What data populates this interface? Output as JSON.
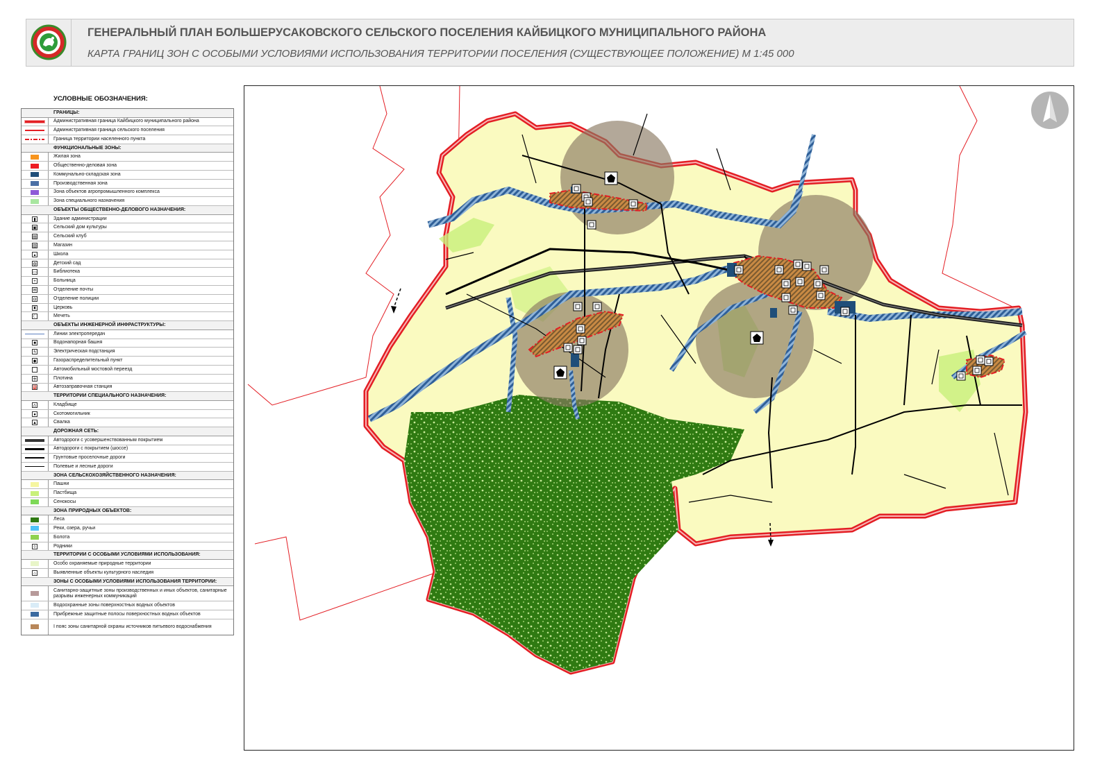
{
  "header": {
    "title": "ГЕНЕРАЛЬНЫЙ ПЛАН БОЛЬШЕРУСАКОВСКОГО СЕЛЬСКОГО ПОСЕЛЕНИЯ КАЙБИЦКОГО МУНИЦИПАЛЬНОГО РАЙОНА",
    "subtitle": "КАРТА ГРАНИЦ ЗОН С ОСОБЫМИ УСЛОВИЯМИ ИСПОЛЬЗОВАНИЯ ТЕРРИТОРИИ ПОСЕЛЕНИЯ (СУЩЕСТВУЮЩЕЕ ПОЛОЖЕНИЕ)  М 1:45 000"
  },
  "legend": {
    "title": "УСЛОВНЫЕ ОБОЗНАЧЕНИЯ:",
    "sections": [
      {
        "title": "ГРАНИЦЫ:",
        "items": [
          {
            "label": "Административная граница Кайбицкого муниципального района",
            "kind": "line",
            "color": "#e31e24",
            "style": "double"
          },
          {
            "label": "Административная граница сельского поселения",
            "kind": "line",
            "color": "#e31e24",
            "style": "solid"
          },
          {
            "label": "Граница территории населенного пункта",
            "kind": "line",
            "color": "#e31e24",
            "style": "dashdot"
          }
        ]
      },
      {
        "title": "ФУНКЦИОНАЛЬНЫЕ ЗОНЫ:",
        "items": [
          {
            "label": "Жилая зона",
            "kind": "box",
            "color": "#f7941d"
          },
          {
            "label": "Общественно-деловая зона",
            "kind": "box",
            "color": "#ed1c24"
          },
          {
            "label": "Коммунально-складская зона",
            "kind": "box",
            "color": "#1f4e79"
          },
          {
            "label": "Производственная зона",
            "kind": "box",
            "color": "#4a6fa5"
          },
          {
            "label": "Зона объектов агропромышленного комплекса",
            "kind": "box",
            "color": "#8e5ad8"
          },
          {
            "label": "Зона специального назначения",
            "kind": "box",
            "color": "#a8e6a0"
          }
        ]
      },
      {
        "title": "ОБЪЕКТЫ ОБЩЕСТВЕННО-ДЕЛОВОГО НАЗНАЧЕНИЯ:",
        "items": [
          {
            "label": "Здание администрации",
            "kind": "icon",
            "glyph": "▮"
          },
          {
            "label": "Сельский дом культуры",
            "kind": "icon",
            "glyph": "▣"
          },
          {
            "label": "Сельский клуб",
            "kind": "icon",
            "glyph": "▤"
          },
          {
            "label": "Магазин",
            "kind": "icon",
            "glyph": "▥"
          },
          {
            "label": "Школа",
            "kind": "icon",
            "glyph": "▴"
          },
          {
            "label": "Детский сад",
            "kind": "icon",
            "glyph": "◍"
          },
          {
            "label": "Библиотека",
            "kind": "icon",
            "glyph": "▭"
          },
          {
            "label": "Больница",
            "kind": "icon",
            "glyph": "+"
          },
          {
            "label": "Отделение почты",
            "kind": "icon",
            "glyph": "✉"
          },
          {
            "label": "Отделение полиции",
            "kind": "icon",
            "glyph": "◘"
          },
          {
            "label": "Церковь",
            "kind": "icon",
            "glyph": "♜"
          },
          {
            "label": "Мечеть",
            "kind": "icon",
            "glyph": "☾"
          }
        ]
      },
      {
        "title": "ОБЪЕКТЫ ИНЖЕНЕРНОЙ ИНФРАСТРУКТУРЫ:",
        "items": [
          {
            "label": "Линии электропередач",
            "kind": "line",
            "color": "#5b7fbf",
            "style": "thin"
          },
          {
            "label": "Водонапорная башня",
            "kind": "icon",
            "glyph": "■"
          },
          {
            "label": "Электрическая подстанция",
            "kind": "icon",
            "glyph": "ϟ"
          },
          {
            "label": "Газораспределительный пункт",
            "kind": "icon",
            "glyph": "◆"
          },
          {
            "label": "Автомобильный мостовой переезд",
            "kind": "icon",
            "glyph": ""
          },
          {
            "label": "Плотина",
            "kind": "icon",
            "glyph": "╪"
          },
          {
            "label": "Автозаправочная станция",
            "kind": "icon",
            "glyph": "⛽"
          }
        ]
      },
      {
        "title": "ТЕРРИТОРИИ СПЕЦИАЛЬНОГО НАЗНАЧЕНИЯ:",
        "items": [
          {
            "label": "Кладбище",
            "kind": "icon",
            "glyph": "⛼"
          },
          {
            "label": "Скотомогильник",
            "kind": "icon",
            "glyph": "●"
          },
          {
            "label": "Свалка",
            "kind": "icon",
            "glyph": "▲"
          }
        ]
      },
      {
        "title": "ДОРОЖНАЯ СЕТЬ:",
        "items": [
          {
            "label": "Автодороги с усовершенствованным покрытием",
            "kind": "line",
            "color": "#333",
            "style": "thick"
          },
          {
            "label": "Автодороги с покрытием (шоссе)",
            "kind": "line",
            "color": "#000",
            "style": "medium"
          },
          {
            "label": "Грунтовые проселочные дороги",
            "kind": "line",
            "color": "#000",
            "style": "solid"
          },
          {
            "label": "Полевые и лесные дороги",
            "kind": "line",
            "color": "#000",
            "style": "thin"
          }
        ]
      },
      {
        "title": "ЗОНА СЕЛЬСКОХОЗЯЙСТВЕННОГО НАЗНАЧЕНИЯ:",
        "items": [
          {
            "label": "Пашни",
            "kind": "box",
            "color": "#f5f5a0"
          },
          {
            "label": "Пастбища",
            "kind": "box",
            "color": "#c8f07a"
          },
          {
            "label": "Сенокосы",
            "kind": "box",
            "color": "#7ed957"
          }
        ]
      },
      {
        "title": "ЗОНА ПРИРОДНЫХ ОБЪЕКТОВ:",
        "items": [
          {
            "label": "Леса",
            "kind": "box",
            "color": "#2f7a12"
          },
          {
            "label": "Реки, озера, ручьи",
            "kind": "box",
            "color": "#4fc3f7"
          },
          {
            "label": "Болота",
            "kind": "box",
            "color": "#8fd24f"
          },
          {
            "label": "Родники",
            "kind": "icon",
            "glyph": "◊"
          }
        ]
      },
      {
        "title": "ТЕРРИТОРИИ С ОСОБЫМИ УСЛОВИЯМИ ИСПОЛЬЗОВАНИЯ:",
        "items": [
          {
            "label": "Особо охраняемые природные территории",
            "kind": "box",
            "color": "#e8f5c8"
          },
          {
            "label": "Выявленные объекты культурного наследия",
            "kind": "icon",
            "glyph": "⌂"
          }
        ]
      },
      {
        "title": "ЗОНЫ С ОСОБЫМИ УСЛОВИЯМИ ИСПОЛЬЗОВАНИЯ ТЕРРИТОРИИ:",
        "items": [
          {
            "label": "Санитарно-защитные зоны производственных и иных объектов, санитарные разрывы инженерных коммуникаций",
            "kind": "box",
            "color": "#b79a9a",
            "tall": true
          },
          {
            "label": "Водоохранные зоны поверхностных водных объектов",
            "kind": "box",
            "color": "#d9ecf7"
          },
          {
            "label": "Прибрежные защитные полосы поверхностных водных объектов",
            "kind": "box",
            "color": "#3b6aa0"
          },
          {
            "label": "I пояс зоны санитарной охраны источников питьевого водоснабжения",
            "kind": "box",
            "color": "#b8875a",
            "tall": true
          }
        ]
      }
    ]
  },
  "colors": {
    "arable": "#fafac0",
    "forest": "#2f7a12",
    "boundary": "#e31e24",
    "sanitary": "#8a7a62",
    "water_strip": "#3b6aa0",
    "residential": "#c9843a"
  }
}
